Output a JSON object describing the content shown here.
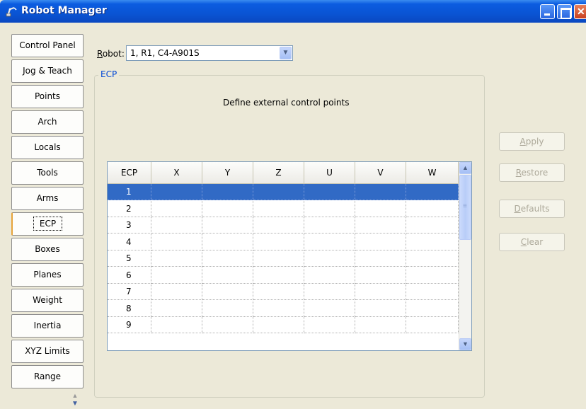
{
  "window": {
    "title": "Robot Manager"
  },
  "nav": {
    "items": [
      {
        "label": "Control Panel"
      },
      {
        "label": "Jog & Teach"
      },
      {
        "label": "Points"
      },
      {
        "label": "Arch"
      },
      {
        "label": "Locals"
      },
      {
        "label": "Tools"
      },
      {
        "label": "Arms"
      },
      {
        "label": "ECP",
        "active": true
      },
      {
        "label": "Boxes"
      },
      {
        "label": "Planes"
      },
      {
        "label": "Weight"
      },
      {
        "label": "Inertia"
      },
      {
        "label": "XYZ Limits"
      },
      {
        "label": "Range"
      }
    ]
  },
  "robot": {
    "label_accel": "R",
    "label_rest": "obot:",
    "selected": "1, R1, C4-A901S"
  },
  "group": {
    "title": "ECP",
    "caption": "Define external control points"
  },
  "grid": {
    "columns": [
      "ECP",
      "X",
      "Y",
      "Z",
      "U",
      "V",
      "W"
    ],
    "rows": [
      {
        "ecp": "1",
        "x": "",
        "y": "",
        "z": "",
        "u": "",
        "v": "",
        "w": "",
        "selected": true
      },
      {
        "ecp": "2",
        "x": "",
        "y": "",
        "z": "",
        "u": "",
        "v": "",
        "w": ""
      },
      {
        "ecp": "3",
        "x": "",
        "y": "",
        "z": "",
        "u": "",
        "v": "",
        "w": ""
      },
      {
        "ecp": "4",
        "x": "",
        "y": "",
        "z": "",
        "u": "",
        "v": "",
        "w": ""
      },
      {
        "ecp": "5",
        "x": "",
        "y": "",
        "z": "",
        "u": "",
        "v": "",
        "w": ""
      },
      {
        "ecp": "6",
        "x": "",
        "y": "",
        "z": "",
        "u": "",
        "v": "",
        "w": ""
      },
      {
        "ecp": "7",
        "x": "",
        "y": "",
        "z": "",
        "u": "",
        "v": "",
        "w": ""
      },
      {
        "ecp": "8",
        "x": "",
        "y": "",
        "z": "",
        "u": "",
        "v": "",
        "w": ""
      },
      {
        "ecp": "9",
        "x": "",
        "y": "",
        "z": "",
        "u": "",
        "v": "",
        "w": ""
      }
    ]
  },
  "actions": {
    "apply": {
      "accel": "A",
      "rest": "pply"
    },
    "restore": {
      "accel": "R",
      "rest": "estore"
    },
    "defaults": {
      "accel": "D",
      "rest": "efaults"
    },
    "clear": {
      "accel": "C",
      "rest": "lear"
    }
  },
  "colors": {
    "titlebar": "#0a54d4",
    "selection": "#316ac5",
    "group_title": "#0046d5",
    "active_tab_accent": "#e6a33a",
    "window_bg": "#ece9d8"
  },
  "icons": {
    "title": "robot-arm-icon",
    "minimize": "minimize-icon",
    "maximize": "maximize-icon",
    "close": "close-icon",
    "dropdown": "chevron-down-icon",
    "scroll_up": "chevron-up-icon",
    "scroll_down": "chevron-down-icon"
  }
}
